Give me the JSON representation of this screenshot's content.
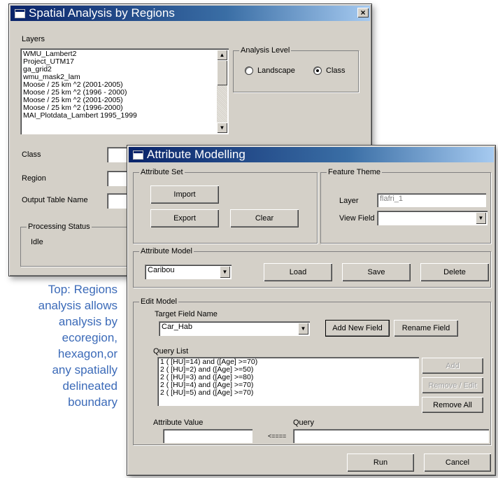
{
  "spatial": {
    "title": "Spatial Analysis by Regions",
    "close_label": "×",
    "layers_label": "Layers",
    "layers": [
      "WMU_Lambert2",
      "Project_UTM17",
      "ga_grid2",
      "wmu_mask2_lam",
      "Moose / 25 km ^2 (2001-2005)",
      "Moose / 25 km ^2 (1996 - 2000)",
      "Moose / 25 km ^2 (2001-2005)",
      "Moose / 25 km ^2 (1996-2000)",
      "MAI_Plotdata_Lambert 1995_1999"
    ],
    "analysis_level_label": "Analysis Level",
    "radio_landscape": "Landscape",
    "radio_class": "Class",
    "selected_level": "Class",
    "class_label": "Class",
    "region_label": "Region",
    "output_table_label": "Output Table Name",
    "processing_status_label": "Processing Status",
    "status_value": "Idle"
  },
  "attr": {
    "title": "Attribute Modelling",
    "attribute_set_label": "Attribute Set",
    "import_label": "Import",
    "export_label": "Export",
    "clear_label": "Clear",
    "feature_theme_label": "Feature Theme",
    "layer_label": "Layer",
    "layer_value": "flafri_1",
    "view_field_label": "View Field",
    "view_field_value": "",
    "attribute_model_label": "Attribute Model",
    "model_value": "Caribou",
    "load_label": "Load",
    "save_label": "Save",
    "delete_label": "Delete",
    "edit_model_label": "Edit Model",
    "target_field_label": "Target Field Name",
    "target_field_value": "Car_Hab",
    "add_new_field_label": "Add New Field",
    "rename_field_label": "Rename Field",
    "query_list_label": "Query List",
    "queries": [
      "1   ( [HU]=14) and ([Age] >=70)",
      "2   ( [HU]=2) and ([Age] >=50)",
      "2   ( [HU]=3) and ([Age] >=80)",
      "2   ( [HU]=4) and ([Age] >=70)",
      "2   ( [HU]=5) and ([Age] >=70)"
    ],
    "add_label": "Add",
    "remove_edit_label": "Remove / Edit",
    "remove_all_label": "Remove All",
    "attribute_value_label": "Attribute Value",
    "query_label": "Query",
    "arrow_label": "<====",
    "attribute_value": "",
    "query_value": "",
    "run_label": "Run",
    "cancel_label": "Cancel"
  },
  "caption": {
    "lines": [
      "Top: Regions",
      "analysis allows",
      "analysis by",
      "ecoregion,",
      "hexagon,or",
      "any spatially",
      "delineated",
      "boundary"
    ],
    "color": "#3b6ab8"
  }
}
